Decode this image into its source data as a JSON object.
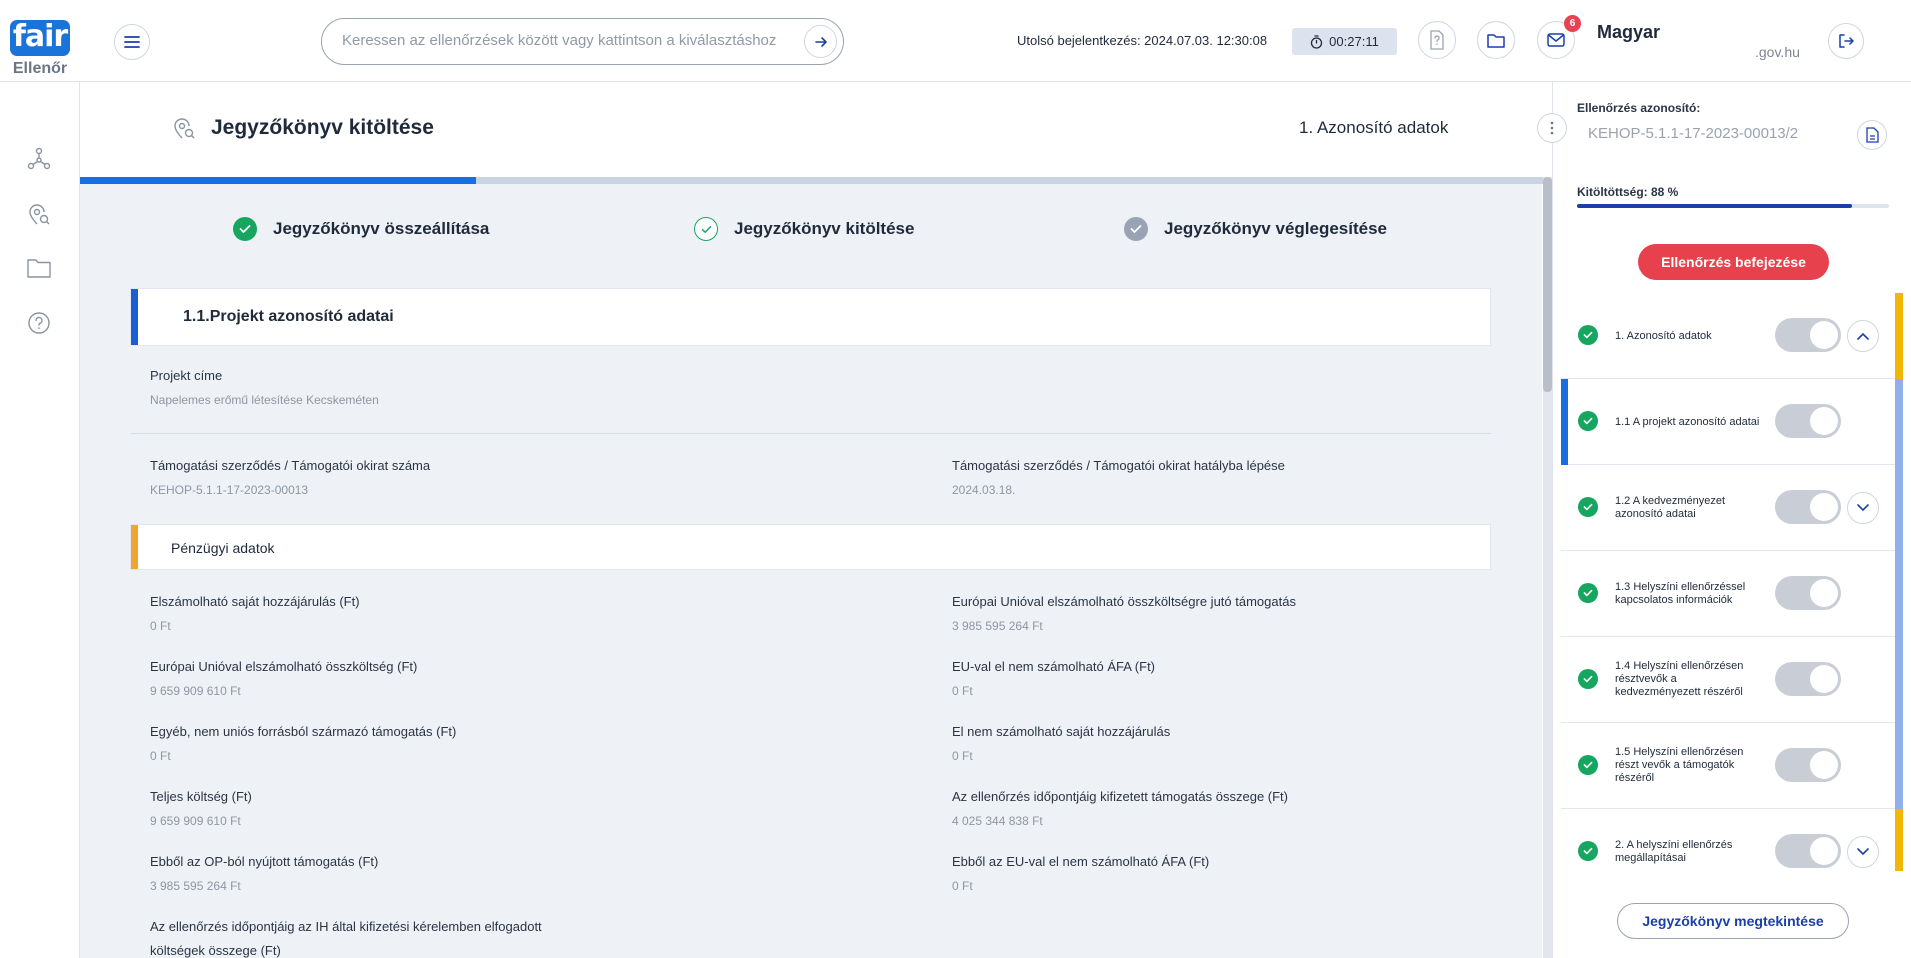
{
  "brand": {
    "logo_text": "fair",
    "subtitle": "Ellenőr",
    "accent": "#1a73d9"
  },
  "header": {
    "search_placeholder": "Keressen az ellenőrzések között vagy kattintson a kiválasztáshoz",
    "last_login": "Utolsó bejelentkezés: 2024.07.03. 12:30:08",
    "timer": "00:27:11",
    "message_count": "6",
    "user_name": "Magyar",
    "user_domain": ".gov.hu"
  },
  "page": {
    "title": "Jegyzőkönyv kitöltése",
    "current_section": "1. Azonosító adatok",
    "progress_fraction": 0.27
  },
  "steps": [
    {
      "label": "Jegyzőkönyv összeállítása",
      "state": "done"
    },
    {
      "label": "Jegyzőkönyv kitöltése",
      "state": "active"
    },
    {
      "label": "Jegyzőkönyv véglegesítése",
      "state": "pending"
    }
  ],
  "section": {
    "title": "1.1.Projekt azonosító adatai",
    "project_title_label": "Projekt címe",
    "project_title_value": "Napelemes erőmű létesítése Kecskeméten",
    "contract_no_label": "Támogatási szerződés / Támogatói okirat száma",
    "contract_no_value": "KEHOP-5.1.1-17-2023-00013",
    "contract_date_label": "Támogatási szerződés / Támogatói okirat hatályba lépése",
    "contract_date_value": "2024.03.18.",
    "finance_title": "Pénzügyi adatok",
    "finance_left": [
      {
        "label": "Elszámolható saját hozzájárulás (Ft)",
        "value": "0 Ft"
      },
      {
        "label": "Európai Unióval elszámolható összköltség (Ft)",
        "value": "9 659 909 610 Ft"
      },
      {
        "label": "Egyéb, nem uniós forrásból származó támogatás (Ft)",
        "value": "0 Ft"
      },
      {
        "label": "Teljes költség (Ft)",
        "value": "9 659 909 610 Ft"
      },
      {
        "label": "Ebből az OP-ból nyújtott támogatás (Ft)",
        "value": "3 985 595 264 Ft"
      }
    ],
    "finance_right": [
      {
        "label": "Európai Unióval elszámolható összköltségre jutó támogatás",
        "value": "3 985 595 264 Ft"
      },
      {
        "label": "EU-val el nem számolható ÁFA (Ft)",
        "value": "0 Ft"
      },
      {
        "label": "El nem számolható saját hozzájárulás",
        "value": "0 Ft"
      },
      {
        "label": "Az ellenőrzés időpontjáig kifizetett támogatás összege (Ft)",
        "value": "4 025 344 838 Ft"
      },
      {
        "label": "Ebből az EU-val el nem számolható ÁFA (Ft)",
        "value": "0 Ft"
      }
    ],
    "accepted_costs_label_1": "Az ellenőrzés időpontjáig az IH által kifizetési kérelemben elfogadott",
    "accepted_costs_label_2": "költségek összege (Ft)"
  },
  "right_panel": {
    "id_label": "Ellenőrzés azonosító:",
    "id_value": "KEHOP-5.1.1-17-2023-00013/2",
    "completion_label": "Kitöltöttség: 88 %",
    "completion_fraction": 0.88,
    "finish_button": "Ellenőrzés befejezése",
    "view_button": "Jegyzőkönyv megtekintése",
    "items": [
      {
        "line1": "1. Azonosító adatok",
        "line2": "",
        "line3": "",
        "chevron": "up",
        "rbar": "#f2b705",
        "selected": false
      },
      {
        "line1": "1.1 A projekt azonosító adatai",
        "line2": "",
        "line3": "",
        "chevron": "",
        "rbar": "#8fb0ea",
        "selected": true
      },
      {
        "line1": "1.2 A kedvezményezet",
        "line2": "azonosító adatai",
        "line3": "",
        "chevron": "down",
        "rbar": "#8fb0ea",
        "selected": false
      },
      {
        "line1": "1.3 Helyszíni ellenőrzéssel",
        "line2": "kapcsolatos információk",
        "line3": "",
        "chevron": "",
        "rbar": "#8fb0ea",
        "selected": false
      },
      {
        "line1": "1.4 Helyszíni ellenőrzésen",
        "line2": "résztvevők a",
        "line3": "kedvezményezett részéről",
        "chevron": "",
        "rbar": "#8fb0ea",
        "selected": false
      },
      {
        "line1": "1.5 Helyszíni ellenőrzésen",
        "line2": "részt vevők a támogatók",
        "line3": "részéről",
        "chevron": "",
        "rbar": "#8fb0ea",
        "selected": false
      },
      {
        "line1": "2. A helyszíni ellenőrzés",
        "line2": "megállapításai",
        "line3": "",
        "chevron": "down",
        "rbar": "#f2b705",
        "selected": false
      }
    ]
  },
  "colors": {
    "success": "#16a660",
    "danger": "#e8414e",
    "primary": "#1a6fe0",
    "warning": "#f2b705"
  }
}
